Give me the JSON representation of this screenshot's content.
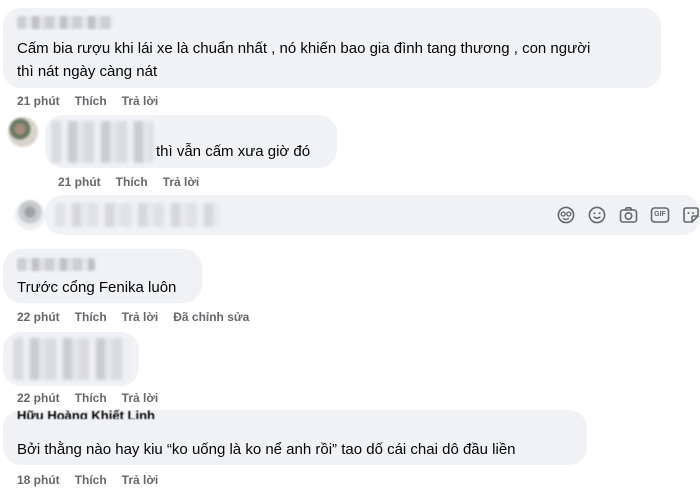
{
  "comments": [
    {
      "text_lines": [
        "Cấm bia rượu khi lái xe là chuẩn nhất , nó khiến bao gia đình tang thương , con người",
        "thì nát ngày càng nát"
      ],
      "time": "21 phút",
      "like": "Thích",
      "reply": "Trả lời"
    },
    {
      "text": "thì vẫn cấm xưa giờ đó",
      "time": "21 phút",
      "like": "Thích",
      "reply": "Trả lời"
    },
    {
      "text": "Trước cổng Fenika luôn",
      "time": "22 phút",
      "like": "Thích",
      "reply": "Trả lời",
      "edited": "Đã chỉnh sửa"
    },
    {
      "time": "22 phút",
      "like": "Thích",
      "reply": "Trả lời"
    },
    {
      "name_partial": "Hữu Hoàng Khiết Linh",
      "text": "Bởi thằng nào hay kiu “ko uống là ko nể anh rồi” tao dố cái chai dô đầu liền",
      "time": "18 phút",
      "like": "Thích",
      "reply": "Trả lời"
    }
  ],
  "reply_box": {
    "icons": [
      "sticker-face-icon",
      "emoji-icon",
      "camera-icon",
      "gif-icon",
      "sticker-icon"
    ],
    "icon_labels": {
      "gif": "GIF"
    }
  },
  "colors": {
    "bubble": "#f0f2f5",
    "meta_text": "#65676b",
    "text": "#050505"
  }
}
